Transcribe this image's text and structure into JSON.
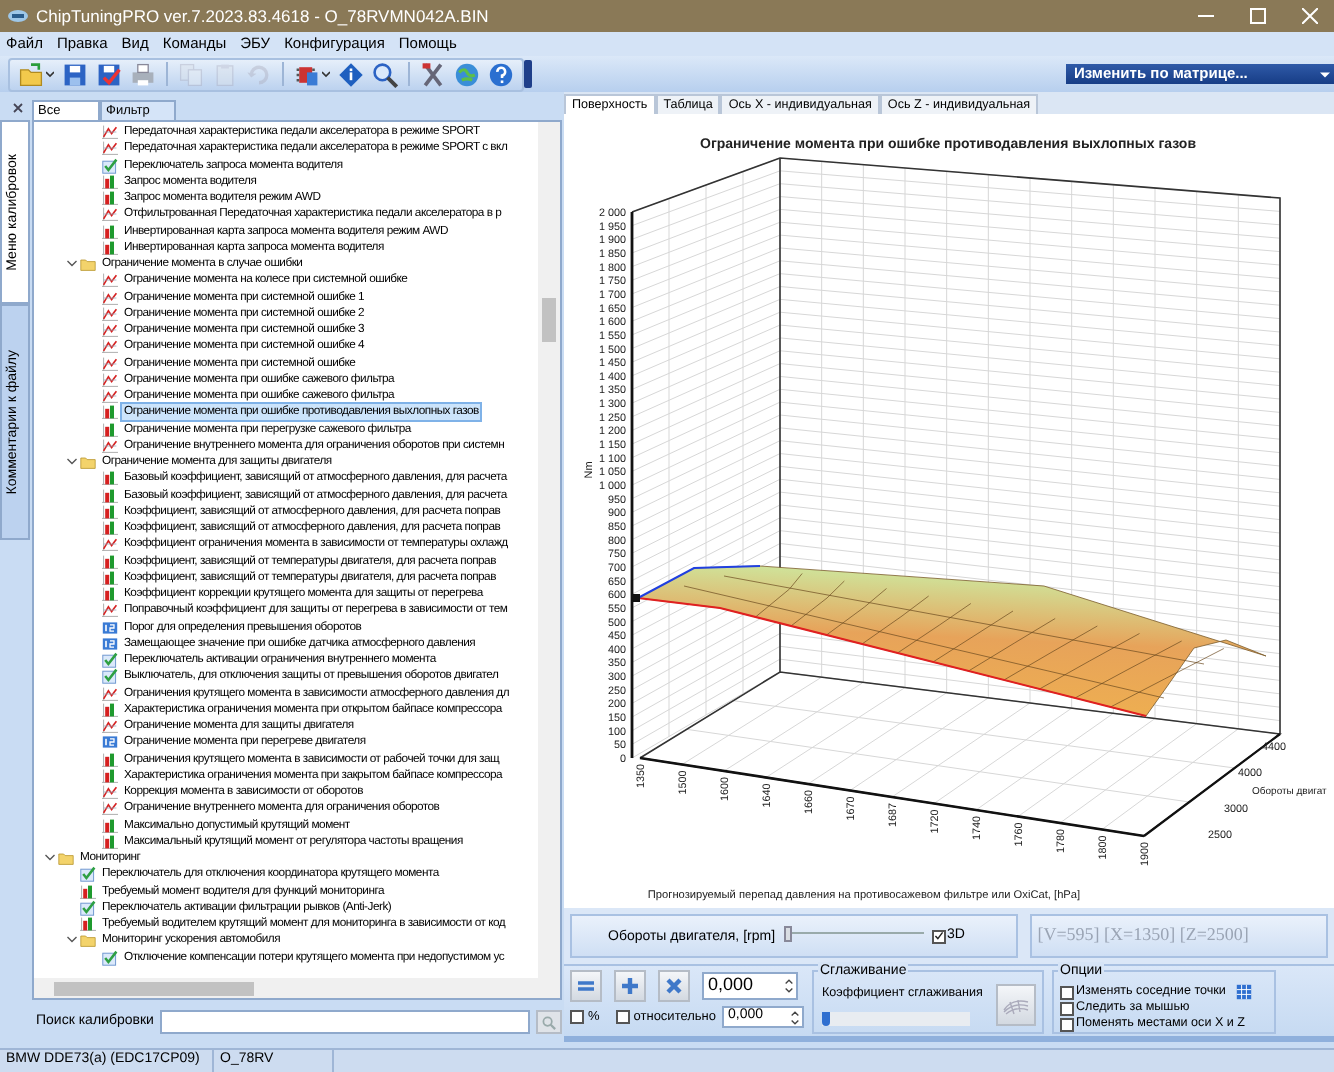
{
  "window": {
    "title": "ChipTuningPRO ver.7.2023.83.4618 - O_78RVMN042A.BIN"
  },
  "menu": [
    "Файл",
    "Правка",
    "Вид",
    "Команды",
    "ЭБУ",
    "Конфигурация",
    "Помощь"
  ],
  "toolbar": [
    {
      "kind": "open",
      "disabled": false,
      "dropdown": true
    },
    {
      "kind": "save",
      "disabled": false,
      "dropdown": false
    },
    {
      "kind": "save-check",
      "disabled": false,
      "dropdown": false
    },
    {
      "kind": "print",
      "disabled": false,
      "dropdown": false
    },
    {
      "kind": "copy",
      "disabled": true,
      "dropdown": false
    },
    {
      "kind": "paste",
      "disabled": true,
      "dropdown": false
    },
    {
      "kind": "undo",
      "disabled": true,
      "dropdown": false
    },
    {
      "kind": "chip",
      "disabled": false,
      "dropdown": true
    },
    {
      "kind": "info",
      "disabled": false,
      "dropdown": false
    },
    {
      "kind": "zoom",
      "disabled": false,
      "dropdown": false
    },
    {
      "kind": "tools",
      "disabled": false,
      "dropdown": false
    },
    {
      "kind": "globe",
      "disabled": false,
      "dropdown": false
    },
    {
      "kind": "help",
      "disabled": false,
      "dropdown": false
    }
  ],
  "matrix_dropdown": {
    "value": "Изменить по матрице..."
  },
  "side_tabs": [
    {
      "label": "Меню калибровок",
      "selected": true
    },
    {
      "label": "Комментарии к файлу",
      "selected": false
    }
  ],
  "filter_tabs": [
    {
      "label": "Все",
      "selected": true
    },
    {
      "label": "Фильтр",
      "selected": false
    }
  ],
  "tree": {
    "items": [
      {
        "kind": "offscreen",
        "children": [
          {
            "kind": "offscreen",
            "children": [
              {
                "kind": "curve",
                "label": "Передаточная характеристика педали акселератора в режиме SPORT",
                "selected": false
              },
              {
                "kind": "curve",
                "label": "Передаточная характеристика педали акселератора в режиме SPORT с вкл",
                "selected": false
              },
              {
                "kind": "switch",
                "label": "Переключатель запроса момента водителя",
                "selected": false
              },
              {
                "kind": "map",
                "label": "Запрос момента водителя",
                "selected": false
              },
              {
                "kind": "map",
                "label": "Запрос момента водителя режим AWD",
                "selected": false
              },
              {
                "kind": "curve",
                "label": "Отфильтрованная Передаточная характеристика педали акселератора в р",
                "selected": false
              },
              {
                "kind": "map",
                "label": "Инвертированная карта запроса момента водителя режим AWD",
                "selected": false
              },
              {
                "kind": "map",
                "label": "Инвертированная карта запроса момента водителя",
                "selected": false
              }
            ]
          },
          {
            "kind": "folder",
            "label": "Ограничение момента в случае ошибки",
            "expanded": true,
            "children": [
              {
                "kind": "curve",
                "label": "Ограничение момента на колесе при системной ошибке",
                "selected": false
              },
              {
                "kind": "curve",
                "label": "Ограничение момента при системной ошибке 1",
                "selected": false
              },
              {
                "kind": "curve",
                "label": "Ограничение момента при системной ошибке 2",
                "selected": false
              },
              {
                "kind": "curve",
                "label": "Ограничение момента при системной ошибке 3",
                "selected": false
              },
              {
                "kind": "curve",
                "label": "Ограничение момента при системной ошибке 4",
                "selected": false
              },
              {
                "kind": "curve",
                "label": "Ограничение момента при системной ошибке",
                "selected": false
              },
              {
                "kind": "curve",
                "label": "Ограничение момента при ошибке сажевого фильтра",
                "selected": false
              },
              {
                "kind": "curve",
                "label": "Ограничение момента при ошибке сажевого фильтра",
                "selected": false
              },
              {
                "kind": "map",
                "label": "Ограничение момента при ошибке противодавления выхлопных газов",
                "selected": true
              },
              {
                "kind": "map",
                "label": "Ограничение момента при перегрузке сажевого фильтра",
                "selected": false
              },
              {
                "kind": "curve",
                "label": "Ограничение внутреннего момента для ограничения оборотов при системн",
                "selected": false
              }
            ]
          },
          {
            "kind": "folder",
            "label": "Ограничение момента для защиты двигателя",
            "expanded": true,
            "children": [
              {
                "kind": "map",
                "label": "Базовый коэффициент, зависящий от атмосферного давления, для расчета",
                "selected": false
              },
              {
                "kind": "map",
                "label": "Базовый коэффициент, зависящий от атмосферного давления, для расчета",
                "selected": false
              },
              {
                "kind": "map",
                "label": "Коэффициент, зависящий от атмосферного давления, для расчета поправ",
                "selected": false
              },
              {
                "kind": "map",
                "label": "Коэффициент, зависящий от атмосферного давления, для расчета поправ",
                "selected": false
              },
              {
                "kind": "curve",
                "label": "Коэффициент ограничения момента в зависимости от температуры охлажд",
                "selected": false
              },
              {
                "kind": "map",
                "label": "Коэффициент, зависящий от температуры двигателя, для расчета поправ",
                "selected": false
              },
              {
                "kind": "map",
                "label": "Коэффициент, зависящий от температуры двигателя, для расчета поправ",
                "selected": false
              },
              {
                "kind": "map",
                "label": "Коэффициент коррекции крутящего момента для защиты от перегрева",
                "selected": false
              },
              {
                "kind": "curve",
                "label": "Поправочный коэффициент для защиты от перегрева в зависимости от тем",
                "selected": false
              },
              {
                "kind": "value",
                "label": "Порог для определения превышения оборотов",
                "selected": false
              },
              {
                "kind": "value",
                "label": "Замещающее значение при ошибке датчика атмосферного давления",
                "selected": false
              },
              {
                "kind": "switch",
                "label": "Переключатель активации ограничения внутреннего момента",
                "selected": false
              },
              {
                "kind": "switch",
                "label": "Выключатель, для отключения защиты от превышения оборотов двигател",
                "selected": false
              },
              {
                "kind": "curve",
                "label": "Ограничения крутящего момента в зависимости атмосферного давления дл",
                "selected": false
              },
              {
                "kind": "map",
                "label": "Характеристика ограничения момента при открытом байпасе компрессора",
                "selected": false
              },
              {
                "kind": "curve",
                "label": "Ограничение момента для защиты двигателя",
                "selected": false
              },
              {
                "kind": "value",
                "label": "Ограничение момента при перегреве двигателя",
                "selected": false
              },
              {
                "kind": "map",
                "label": "Ограничения крутящего момента в зависимости от рабочей точки для защ",
                "selected": false
              },
              {
                "kind": "map",
                "label": "Характеристика ограничения момента при закрытом байпасе компрессора",
                "selected": false
              },
              {
                "kind": "curve",
                "label": "Коррекция момента в зависимости от оборотов",
                "selected": false
              },
              {
                "kind": "curve",
                "label": "Ограничение внутреннего момента для ограничения оборотов",
                "selected": false
              },
              {
                "kind": "map",
                "label": "Максимально допустимый крутящий момент",
                "selected": false
              },
              {
                "kind": "map",
                "label": "Максимальный крутящий момент от регулятора частоты вращения",
                "selected": false
              }
            ]
          }
        ]
      },
      {
        "kind": "folder",
        "label": "Мониторинг",
        "expanded": true,
        "children": [
          {
            "kind": "switch",
            "label": "Переключатель для отключения координатора крутящего момента",
            "selected": false
          },
          {
            "kind": "map",
            "label": "Требуемый момент водителя для функций мониторинга",
            "selected": false
          },
          {
            "kind": "switch",
            "label": "Переключатель активации фильтрации рывков (Anti-Jerk)",
            "selected": false
          },
          {
            "kind": "map",
            "label": "Требуемый водителем крутящий момент для мониторинга в зависимости от код",
            "selected": false
          },
          {
            "kind": "folder",
            "label": "Мониторинг ускорения автомобиля",
            "expanded": true,
            "children": [
              {
                "kind": "switch",
                "label": "Отключение компенсации потери крутящего момента при недопустимом ус",
                "selected": false
              }
            ]
          }
        ]
      }
    ]
  },
  "search": {
    "label": "Поиск калибровки"
  },
  "status_bar": [
    "BMW DDE73(a) (EDC17CP09)",
    "O_78RV"
  ],
  "view_tabs": [
    {
      "label": "Поверхность",
      "selected": true
    },
    {
      "label": "Таблица",
      "selected": false
    },
    {
      "label": "Ось X - индивидуальная",
      "selected": false
    },
    {
      "label": "Ось Z - индивидуальная",
      "selected": false
    }
  ],
  "surface_chart": {
    "title": "Ограничение момента при ошибке противодавления выхлопных газов",
    "y_label": "Nm",
    "y_ticks": [
      "2 000",
      "1 950",
      "1 900",
      "1 850",
      "1 800",
      "1 750",
      "1 700",
      "1 650",
      "1 600",
      "1 550",
      "1 500",
      "1 450",
      "1 400",
      "1 350",
      "1 300",
      "1 250",
      "1 200",
      "1 150",
      "1 100",
      "1 050",
      "1 000",
      "950",
      "900",
      "850",
      "800",
      "750",
      "700",
      "650",
      "600",
      "550",
      "500",
      "450",
      "400",
      "350",
      "300",
      "250",
      "200",
      "150",
      "100",
      "50",
      "0"
    ],
    "x_label": "Прогнозируемый перепад давления на противосажевом фильтре или OxiCat, [hPa]",
    "x_ticks": [
      "1350",
      "1500",
      "1600",
      "1640",
      "1660",
      "1670",
      "1687",
      "1720",
      "1740",
      "1760",
      "1780",
      "1800",
      "1900"
    ],
    "z_label": "Обороты двигат",
    "z_ticks": [
      "2500",
      "3000",
      "4000",
      "4400"
    ]
  },
  "axis_control": {
    "label": "Обороты двигателя, [rpm]",
    "level": 0,
    "three_d": {
      "label": "3D",
      "checked": true
    },
    "readout": "[V=595] [X=1350] [Z=2500]"
  },
  "edit": {
    "buttons": [
      {
        "kind": "equals"
      },
      {
        "kind": "plus"
      },
      {
        "kind": "multiply"
      }
    ],
    "value": "0,000",
    "percent": {
      "label": "%",
      "checked": false
    },
    "relative": {
      "label": "относительно",
      "checked": false
    },
    "relative_value": "0,000"
  },
  "smoothing": {
    "title": "Сглаживание",
    "label": "Коэффициент сглаживания",
    "level": 0
  },
  "options": {
    "title": "Опции",
    "items": [
      {
        "label": "Изменять соседние точки",
        "checked": false
      },
      {
        "label": "Следить за мышью",
        "checked": false
      },
      {
        "label": "Поменять местами оси X и Z",
        "checked": false
      }
    ]
  }
}
